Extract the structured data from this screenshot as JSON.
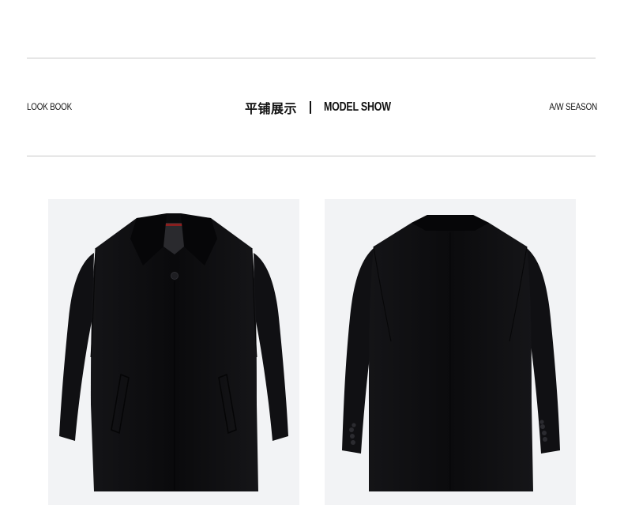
{
  "header": {
    "left_label": "LOOK BOOK",
    "center_cn": "平铺展示",
    "center_en": "MODEL SHOW",
    "right_label": "A/W SEASON"
  },
  "colors": {
    "background": "#ffffff",
    "rule": "#c8c8c8",
    "photo_bg": "#f2f3f5",
    "coat": "#0c0c0e",
    "label_red": "#8a1f1f"
  },
  "photos": [
    {
      "name": "coat-front-photo",
      "view": "front"
    },
    {
      "name": "coat-back-photo",
      "view": "back"
    }
  ]
}
